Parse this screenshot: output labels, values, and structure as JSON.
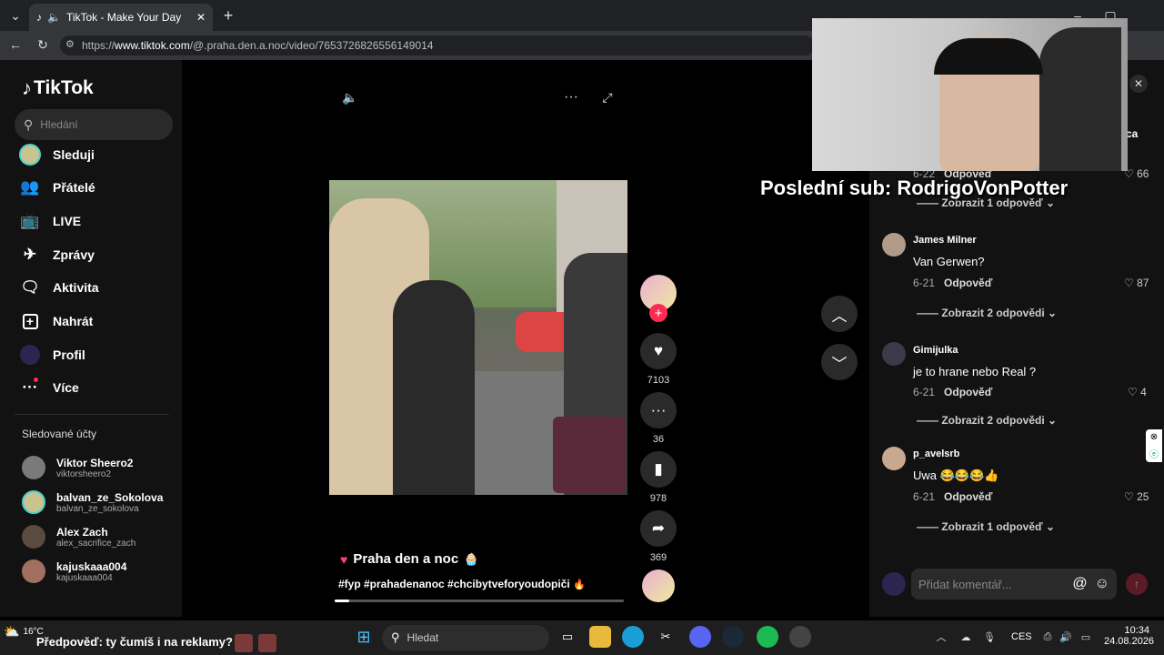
{
  "browser": {
    "tab_title": "TikTok - Make Your Day",
    "url_prefix": "https://",
    "url_domain": "www.tiktok.com",
    "url_path": "/@.praha.den.a.noc/video/7653726826556149014"
  },
  "sidebar": {
    "logo": "TikTok",
    "search_placeholder": "Hledání",
    "items": [
      {
        "label": "Sleduji",
        "icon": "avatar-icon"
      },
      {
        "label": "Přátelé",
        "icon": "friends-icon"
      },
      {
        "label": "LIVE",
        "icon": "live-icon"
      },
      {
        "label": "Zprávy",
        "icon": "messages-icon"
      },
      {
        "label": "Aktivita",
        "icon": "activity-icon"
      },
      {
        "label": "Nahrát",
        "icon": "upload-icon"
      },
      {
        "label": "Profil",
        "icon": "profile-icon"
      },
      {
        "label": "Více",
        "icon": "more-icon"
      }
    ],
    "followed_title": "Sledované účty",
    "followed": [
      {
        "name": "Viktor Sheero2",
        "handle": "viktorsheero2"
      },
      {
        "name": "balvan_ze_Sokolova",
        "handle": "balvan_ze_sokolova"
      },
      {
        "name": "Alex Zach",
        "handle": "alex_sacrifice_zach"
      },
      {
        "name": "kajuskaaa004",
        "handle": "kajuskaaa004"
      }
    ]
  },
  "video": {
    "title": "Praha den a noc",
    "hashtags": "#fyp #prahadenanoc #chcibytveforyoudopiči",
    "likes": "7103",
    "comments": "36",
    "saves": "978",
    "shares": "369",
    "progress_percent": 5
  },
  "overlay": {
    "last_sub": "Poslední sub: RodrigoVonPotter"
  },
  "comments": {
    "partial_letters": "ca",
    "partial_date": "6-22",
    "partial_reply": "Odpověď",
    "partial_likes": "66",
    "partial_view_replies": "Zobrazit 1 odpověď",
    "items": [
      {
        "name": "James Milner",
        "text": "Van Gerwen?",
        "date": "6-21",
        "reply": "Odpověď",
        "likes": "87",
        "view_replies": "Zobrazit 2 odpovědi"
      },
      {
        "name": "Gimijulka",
        "text": "je to hrane nebo Real ?",
        "date": "6-21",
        "reply": "Odpověď",
        "likes": "4",
        "view_replies": "Zobrazit 2 odpovědi"
      },
      {
        "name": "p_avelsrb",
        "text": "Uwa 😂😂😂👍",
        "date": "6-21",
        "reply": "Odpověď",
        "likes": "25",
        "view_replies": "Zobrazit 1 odpověď"
      }
    ],
    "input_placeholder": "Přidat komentář..."
  },
  "taskbar": {
    "weather_temp": "16°C",
    "ticker": "Předpověď: ty čumíš i na reklamy?",
    "search_placeholder": "Hledat",
    "language": "CES",
    "time": "10:34",
    "date": "24.08.2026"
  }
}
